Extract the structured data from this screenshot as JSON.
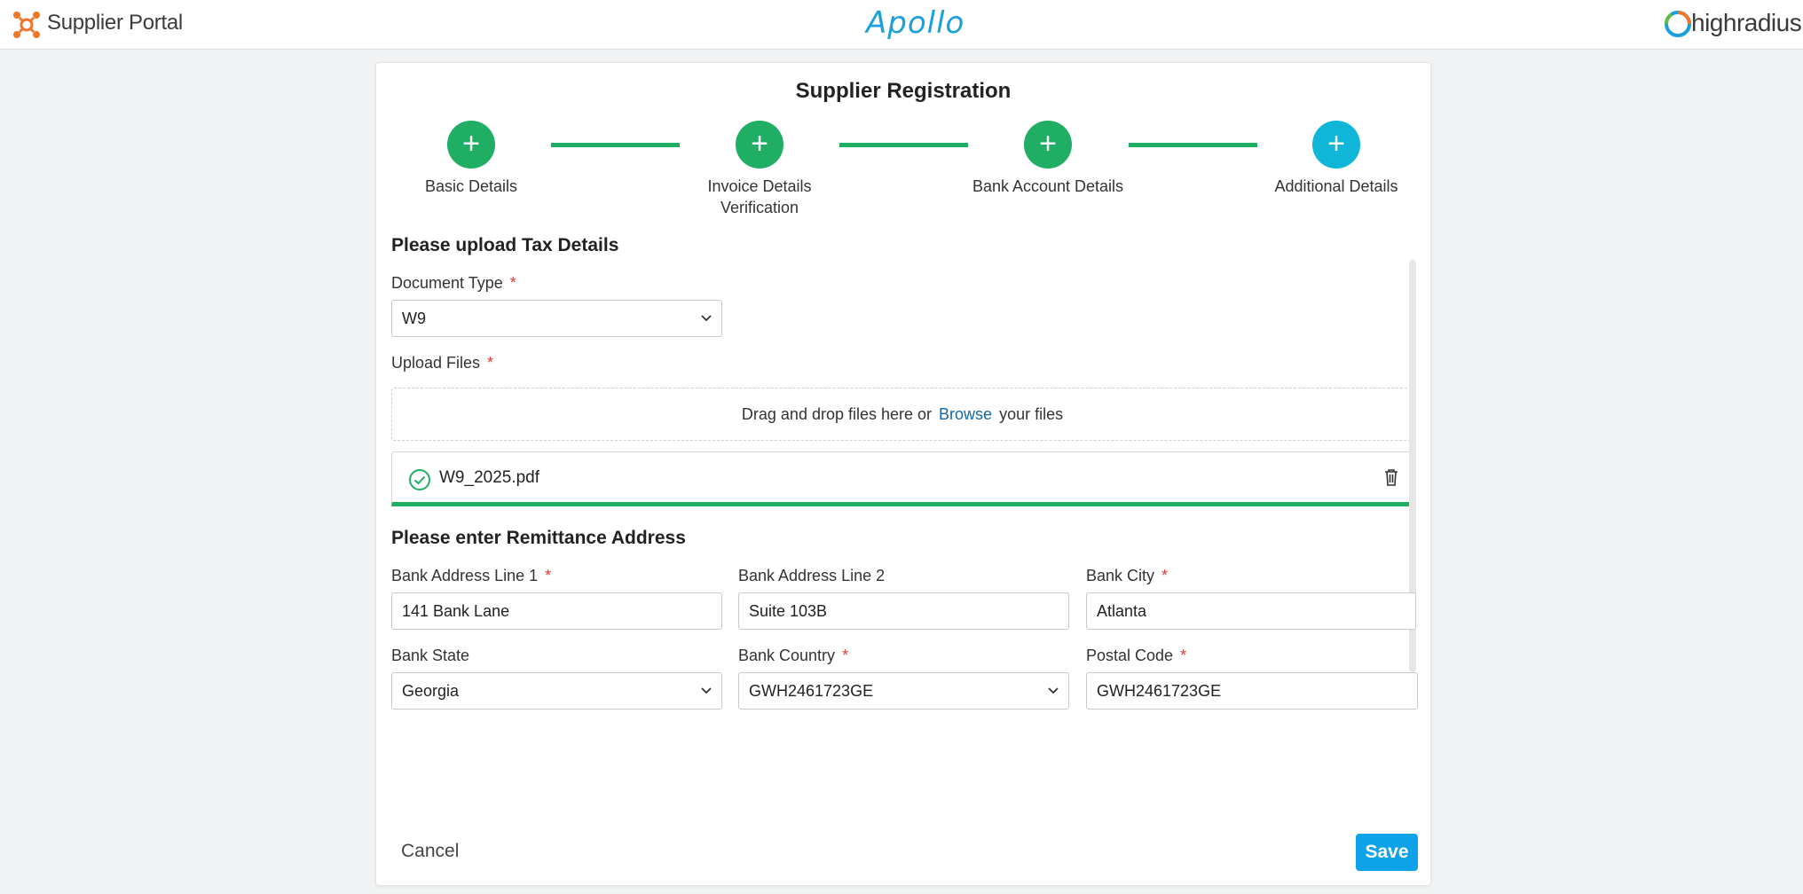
{
  "header": {
    "portal_name": "Supplier Portal",
    "center_logo": "Apollo",
    "right_logo": "highradius"
  },
  "card": {
    "title": "Supplier Registration"
  },
  "stepper": {
    "steps": [
      {
        "label": "Basic Details",
        "icon": "plus-icon",
        "status": "done"
      },
      {
        "label": "Invoice Details",
        "label2": "Verification",
        "icon": "plus-icon",
        "status": "done"
      },
      {
        "label": "Bank Account Details",
        "icon": "plus-icon",
        "status": "done"
      },
      {
        "label": "Additional Details",
        "icon": "plus-icon",
        "status": "active"
      }
    ],
    "colors": {
      "done": "#1fae63",
      "active": "#10b6d8"
    }
  },
  "tax": {
    "title": "Please upload Tax Details",
    "document_type_label": "Document Type",
    "document_type_value": "W9",
    "upload_label": "Upload Files",
    "drop_text_before": "Drag and drop files here or",
    "browse_label": "Browse",
    "drop_text_after": "your files",
    "file_name": "W9_2025.pdf",
    "upload_progress": 1.0
  },
  "remittance": {
    "title": "Please enter Remittance Address",
    "fields": {
      "addr1": {
        "label": "Bank Address Line 1",
        "value": "141 Bank Lane",
        "required": "*"
      },
      "addr2": {
        "label": "Bank Address Line 2",
        "value": "Suite 103B"
      },
      "city": {
        "label": "Bank City",
        "value": "Atlanta",
        "required": "*"
      },
      "state": {
        "label": "Bank State",
        "value": "Georgia"
      },
      "country": {
        "label": "Bank Country",
        "value": "GWH2461723GE",
        "required": "*"
      },
      "postal": {
        "label": "Postal Code",
        "value": "GWH2461723GE",
        "required": "*"
      }
    }
  },
  "actions": {
    "cancel_label": "Cancel",
    "save_label": "Save"
  },
  "colors": {
    "accent_green": "#1fae63",
    "save_blue": "#0ea2e8",
    "link_blue": "#1668a8",
    "required_red": "#e53935"
  }
}
